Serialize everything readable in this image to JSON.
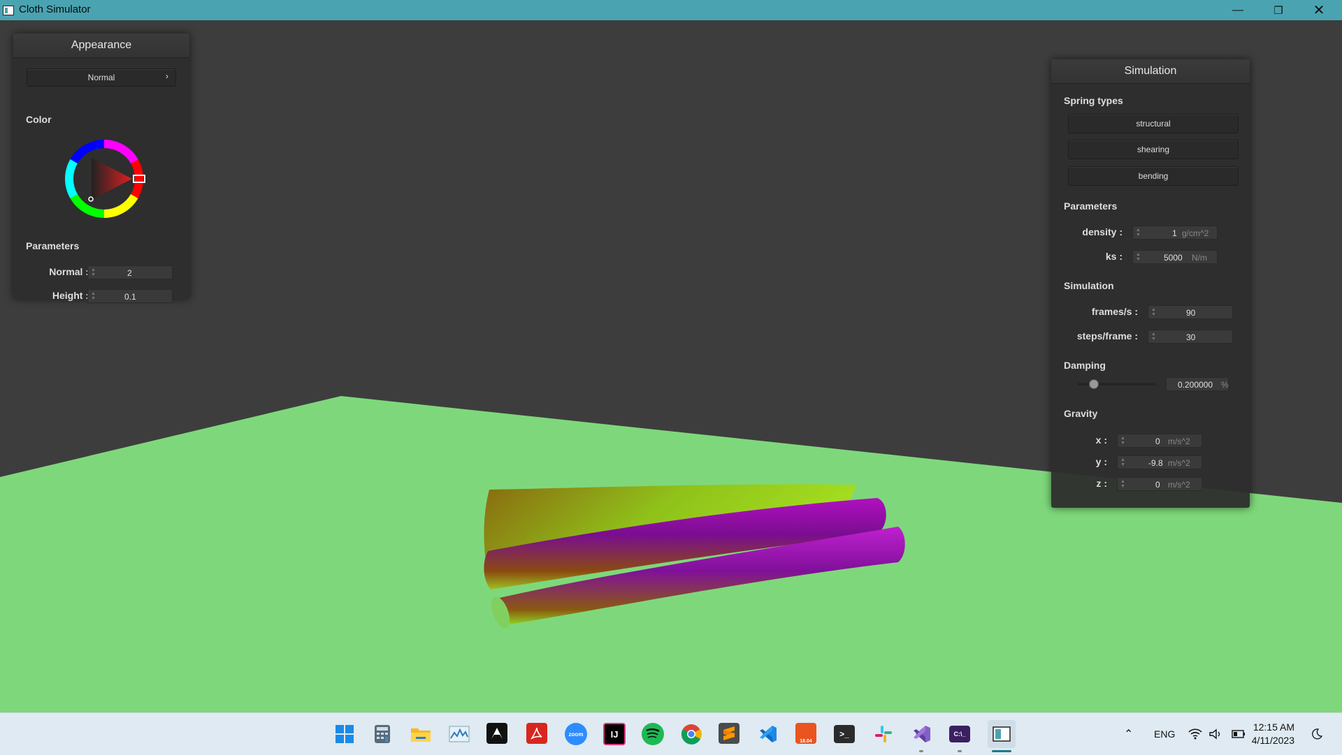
{
  "window": {
    "title": "Cloth Simulator"
  },
  "appearance": {
    "title": "Appearance",
    "mode_value": "Normal",
    "color_label": "Color",
    "parameters_label": "Parameters",
    "normal_label": "Normal :",
    "normal_value": "2",
    "height_label": "Height :",
    "height_value": "0.1"
  },
  "simulation_panel": {
    "title": "Simulation",
    "spring_types_label": "Spring types",
    "spring_buttons": [
      "structural",
      "shearing",
      "bending"
    ],
    "parameters_label": "Parameters",
    "density_label": "density :",
    "density_value": "1",
    "density_unit": "g/cm^2",
    "ks_label": "ks :",
    "ks_value": "5000",
    "ks_unit": "N/m",
    "simulation_label": "Simulation",
    "fps_label": "frames/s :",
    "fps_value": "90",
    "steps_label": "steps/frame :",
    "steps_value": "30",
    "damping_label": "Damping",
    "damping_value": "0.200000",
    "damping_unit": "%",
    "damping_fraction": 0.2,
    "gravity_label": "Gravity",
    "gx_label": "x :",
    "gx_value": "0",
    "gy_label": "y :",
    "gy_value": "-9.8",
    "gz_label": "z :",
    "gz_value": "0",
    "gravity_unit": "m/s^2"
  },
  "colors": {
    "titlebar": "#4aa3b1",
    "ground": "#7ed87b",
    "background": "#3d3d3d",
    "selected_color": "#e03030"
  },
  "taskbar": {
    "icons": [
      "windows-start-icon",
      "calculator-icon",
      "file-explorer-icon",
      "performance-monitor-icon",
      "inkscape-icon",
      "acrobat-icon",
      "zoom-icon",
      "intellij-icon",
      "spotify-icon",
      "chrome-icon",
      "sublime-text-icon",
      "vscode-icon",
      "ubuntu-icon",
      "terminal-icon",
      "slack-icon",
      "visual-studio-icon",
      "command-prompt-icon",
      "cloth-simulator-app-icon"
    ],
    "zoom_text": "zoom",
    "intellij_text": "IJ",
    "ubuntu_text": "18.04",
    "language": "ENG",
    "time": "12:15 AM",
    "date": "4/11/2023"
  }
}
